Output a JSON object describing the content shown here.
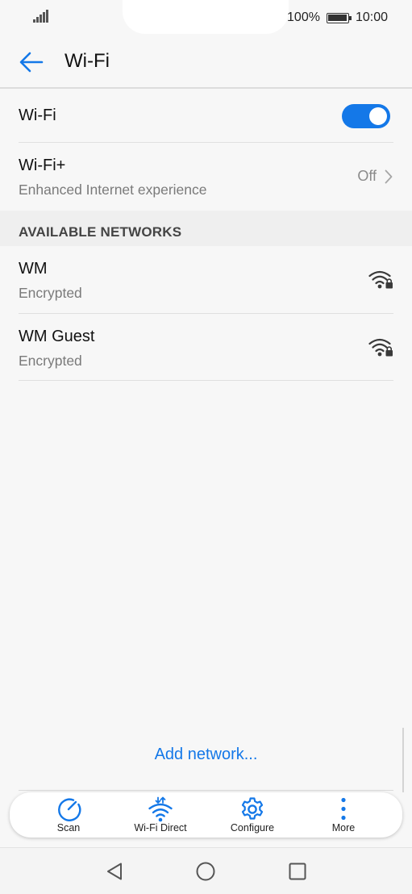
{
  "status_bar": {
    "battery": "100%",
    "time": "10:00"
  },
  "header": {
    "title": "Wi-Fi"
  },
  "wifi_toggle": {
    "label": "Wi-Fi",
    "state": "on"
  },
  "wifi_plus": {
    "label": "Wi-Fi+",
    "subtitle": "Enhanced Internet experience",
    "value": "Off"
  },
  "networks_section": {
    "heading": "AVAILABLE NETWORKS"
  },
  "networks": [
    {
      "name": "WM",
      "security": "Encrypted",
      "icon": "wifi-lock-icon"
    },
    {
      "name": "WM Guest",
      "security": "Encrypted",
      "icon": "wifi-lock-icon"
    }
  ],
  "add_network": {
    "label": "Add network..."
  },
  "toolbar": {
    "items": [
      {
        "label": "Scan",
        "icon": "scan-icon"
      },
      {
        "label": "Wi-Fi Direct",
        "icon": "wifi-direct-icon"
      },
      {
        "label": "Configure",
        "icon": "gear-icon"
      },
      {
        "label": "More",
        "icon": "more-vert-icon"
      }
    ]
  },
  "colors": {
    "accent": "#1478e8",
    "background": "#f7f7f7",
    "section": "#efefef"
  }
}
